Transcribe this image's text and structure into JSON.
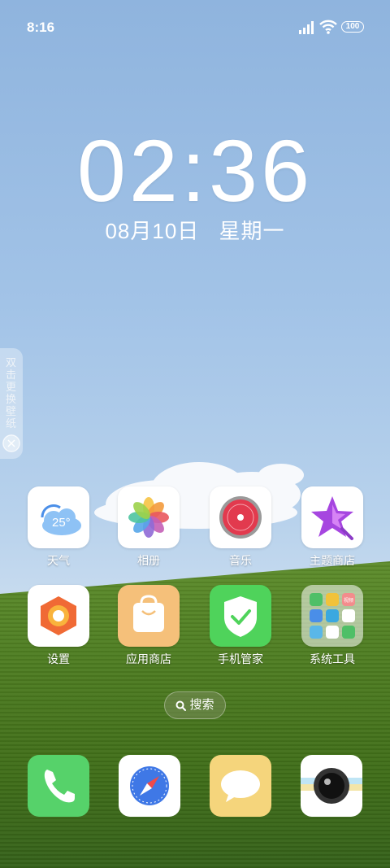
{
  "status_bar": {
    "time": "8:16",
    "battery_label": "100",
    "icons": [
      "signal-icon",
      "wifi-icon",
      "battery-icon"
    ]
  },
  "clock": {
    "time": "02:36",
    "date": "08月10日",
    "weekday": "星期一"
  },
  "side_hint": {
    "text": "双击更换壁纸",
    "close_icon": "close-icon"
  },
  "apps_row1": [
    {
      "label": "天气",
      "icon": "weather-icon"
    },
    {
      "label": "相册",
      "icon": "photos-icon"
    },
    {
      "label": "音乐",
      "icon": "music-icon"
    },
    {
      "label": "主题商店",
      "icon": "theme-store-icon"
    }
  ],
  "apps_row2": [
    {
      "label": "设置",
      "icon": "settings-icon"
    },
    {
      "label": "应用商店",
      "icon": "app-store-icon"
    },
    {
      "label": "手机管家",
      "icon": "phone-manager-icon"
    },
    {
      "label": "系统工具",
      "icon": "system-tools-folder-icon"
    }
  ],
  "weather_temp": "25°",
  "folder_badge": "视频",
  "search": {
    "label": "搜索",
    "icon": "search-icon"
  },
  "dock": [
    {
      "icon": "phone-icon"
    },
    {
      "icon": "browser-icon"
    },
    {
      "icon": "messages-icon"
    },
    {
      "icon": "camera-icon"
    }
  ],
  "colors": {
    "sky": "#a2c3e7",
    "grass": "#4f7e22"
  }
}
